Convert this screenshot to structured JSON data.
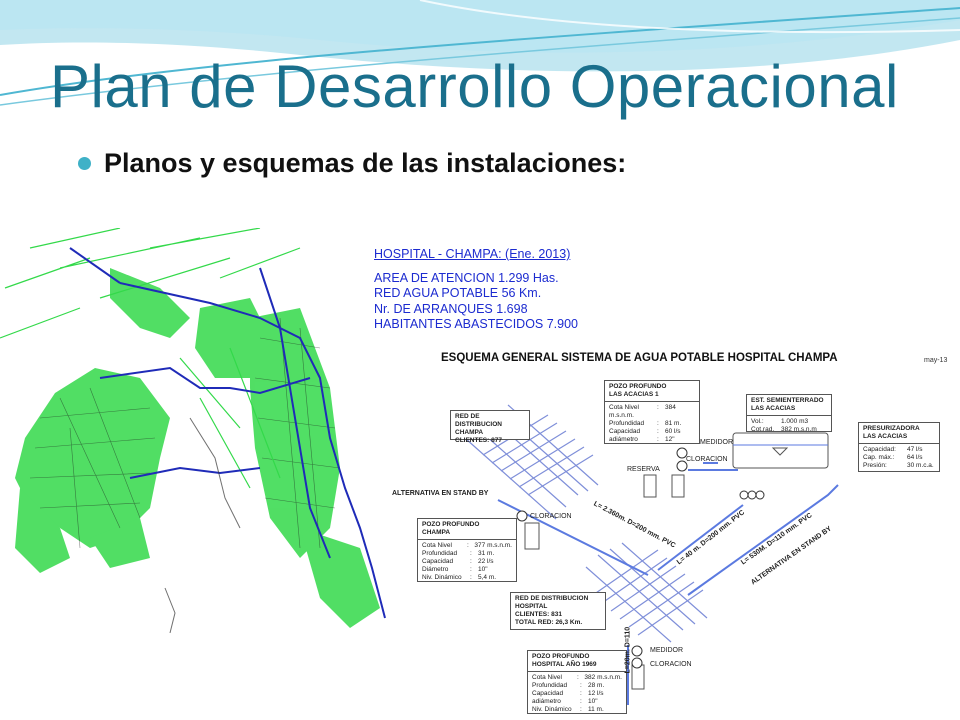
{
  "title": "Plan de Desarrollo Operacional",
  "bullet": "Planos y esquemas de las instalaciones:",
  "map_info": {
    "title": "HOSPITAL - CHAMPA:  (Ene. 2013)",
    "lines": [
      "AREA DE ATENCION 1.299 Has.",
      "RED AGUA POTABLE  56 Km.",
      "Nr. DE ARRANQUES   1.698",
      "HABITANTES ABASTECIDOS    7.900"
    ]
  },
  "scheme": {
    "title": "ESQUEMA GENERAL SISTEMA DE AGUA POTABLE   HOSPITAL CHAMPA",
    "date": "may-13",
    "boxes": {
      "pozo_acacias": {
        "header": [
          "POZO PROFUNDO",
          "LAS ACACIAS   1"
        ],
        "rows": [
          [
            "Cota Nivel",
            ":",
            "384"
          ],
          [
            "m.s.n.m.",
            "",
            ""
          ],
          [
            "Profundidad",
            ":",
            "81 m."
          ],
          [
            "Capacidad",
            ":",
            "60 l/s"
          ],
          [
            "adiámetro",
            ":",
            "12\""
          ]
        ]
      },
      "est_acacias": {
        "header": [
          "EST.  SEMIENTERRADO",
          "LAS ACACIAS"
        ],
        "rows": [
          [
            "Vol.:",
            "",
            "1.000 m3"
          ],
          [
            "Cot.rad.",
            "",
            "382 m.s.n.m"
          ]
        ]
      },
      "red_champa": {
        "header": [
          "RED DE DISTRIBUCION",
          "CHAMPA",
          "CLIENTES:      877"
        ],
        "rows": []
      },
      "presurizadora": {
        "header": [
          "PRESURIZADORA",
          "LAS ACACIAS"
        ],
        "rows": [
          [
            "Capacidad:",
            "",
            "47 l/s"
          ],
          [
            "Cap. máx.:",
            "",
            "64 l/s"
          ],
          [
            "Presión:",
            "",
            "30 m.c.a."
          ]
        ]
      },
      "pozo_champa": {
        "header": [
          "POZO PROFUNDO",
          "CHAMPA"
        ],
        "rows": [
          [
            "Cota Nivel",
            ":",
            "377 m.s.n.m."
          ],
          [
            "Profundidad",
            ":",
            "31 m."
          ],
          [
            "Capacidad",
            ":",
            "22 l/s"
          ],
          [
            "Diámetro",
            ":",
            "10\""
          ],
          [
            "Niv. Dinámico",
            ":",
            "5,4 m."
          ]
        ]
      },
      "red_hospital": {
        "header": [
          "RED DE DISTRIBUCION",
          "HOSPITAL",
          "CLIENTES:   831",
          "TOTAL RED:    26,3 Km."
        ],
        "rows": []
      },
      "pozo_hospital": {
        "header": [
          "POZO PROFUNDO",
          "HOSPITAL  AÑO 1969"
        ],
        "rows": [
          [
            "Cota Nivel",
            ":",
            "382 m.s.n.m."
          ],
          [
            "Profundidad",
            ":",
            "28 m."
          ],
          [
            "Capacidad",
            ":",
            "12 l/s"
          ],
          [
            "adiámetro",
            ":",
            "10\""
          ],
          [
            "Niv. Dinámico",
            ":",
            "11 m."
          ]
        ]
      }
    },
    "labels": {
      "medidor_top": "MEDIDOR",
      "cloracion_top": "CLORACION",
      "reserva": "RESERVA",
      "alternativa_standby": "ALTERNATIVA EN STAND BY",
      "cloracion_champa": "CLORACION",
      "medidor_bottom": "MEDIDOR",
      "cloracion_bottom": "CLORACION"
    },
    "pipes": {
      "pipe1": "L= 2.360m. D=200 mm. PVC",
      "pipe2": "L= 40 m. D=200 mm. PVC",
      "pipe3": "L= 530M. D=110 mm. PVC",
      "pipe3_alt": "ALTERNATIVA EN STAND BY",
      "pipe4": "L=20m. D=110"
    }
  }
}
